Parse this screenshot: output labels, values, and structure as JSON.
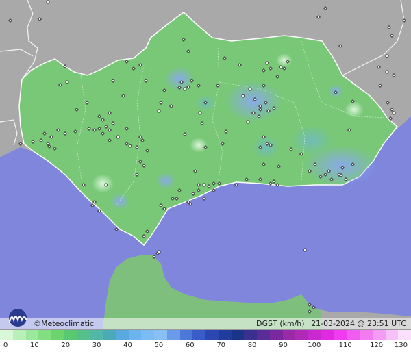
{
  "map": {
    "brand": "©Meteoclimatic",
    "variable": "DGST (km/h)",
    "datetime": "21-03-2024 @ 23:51 UTC",
    "colors": {
      "sea": "#7f86dc",
      "land_outside": "#a9a9aa",
      "region": "#78c878",
      "morocco": "#7fbf7e",
      "borders": "#ffffff",
      "station": "#222222"
    }
  },
  "legend": {
    "ticks": [
      "0",
      "10",
      "20",
      "30",
      "40",
      "50",
      "60",
      "70",
      "80",
      "90",
      "100",
      "110",
      "120",
      "130"
    ],
    "colors": [
      "#d8f8d8",
      "#b8f0b8",
      "#9ce89c",
      "#82e082",
      "#6cd46c",
      "#5ac870",
      "#56c08c",
      "#50b8a4",
      "#4aaab8",
      "#5aa8e0",
      "#6cb4f0",
      "#7cbcf4",
      "#88c0f4",
      "#6a9ae8",
      "#4c78d8",
      "#3a5cc8",
      "#2c48b0",
      "#203c9c",
      "#1a3488",
      "#3a3090",
      "#5a2c98",
      "#7a28a0",
      "#9a2aa8",
      "#b02ab8",
      "#c82ad0",
      "#e02ae0",
      "#f03cf0",
      "#f05cf0",
      "#f07cf0",
      "#f49cf4",
      "#f8c0f8",
      "#fbe0fb"
    ]
  }
}
